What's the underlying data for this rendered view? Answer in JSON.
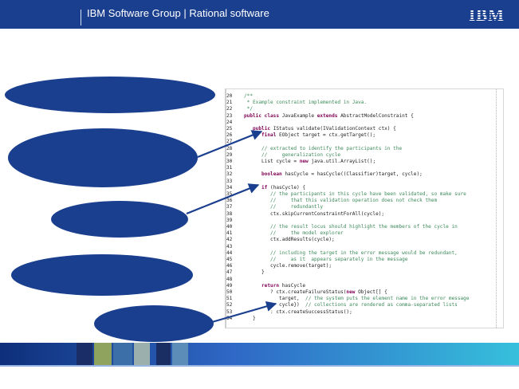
{
  "header": {
    "title": "IBM Software Group  |  Rational software",
    "logo": "IBM"
  },
  "code": {
    "lines": [
      {
        "num": "20",
        "parts": [
          {
            "t": "cm",
            "s": "/**"
          }
        ]
      },
      {
        "num": "21",
        "parts": [
          {
            "t": "cm",
            "s": " * Example constraint implemented in Java."
          }
        ]
      },
      {
        "num": "22",
        "parts": [
          {
            "t": "cm",
            "s": " */"
          }
        ]
      },
      {
        "num": "23",
        "parts": [
          {
            "t": "kw",
            "s": "public class "
          },
          {
            "t": "tx",
            "s": "JavaExample "
          },
          {
            "t": "kw",
            "s": "extends "
          },
          {
            "t": "tx",
            "s": "AbstractModelConstraint {"
          }
        ]
      },
      {
        "num": "24",
        "parts": []
      },
      {
        "num": "25",
        "parts": [
          {
            "t": "tx",
            "s": "   "
          },
          {
            "t": "kw",
            "s": "public "
          },
          {
            "t": "tx",
            "s": "IStatus validate(IValidationContext ctx) {"
          }
        ]
      },
      {
        "num": "26",
        "parts": [
          {
            "t": "tx",
            "s": "      "
          },
          {
            "t": "kw",
            "s": "final "
          },
          {
            "t": "tx",
            "s": "EObject target = ctx.getTarget();"
          }
        ]
      },
      {
        "num": "27",
        "parts": []
      },
      {
        "num": "28",
        "parts": [
          {
            "t": "cm",
            "s": "      // extracted to identify the participants in the"
          }
        ]
      },
      {
        "num": "29",
        "parts": [
          {
            "t": "cm",
            "s": "      //     generalization cycle"
          }
        ]
      },
      {
        "num": "30",
        "parts": [
          {
            "t": "tx",
            "s": "      List cycle = "
          },
          {
            "t": "kw",
            "s": "new "
          },
          {
            "t": "tx",
            "s": "java.util.ArrayList();"
          }
        ]
      },
      {
        "num": "31",
        "parts": []
      },
      {
        "num": "32",
        "parts": [
          {
            "t": "tx",
            "s": "      "
          },
          {
            "t": "kw",
            "s": "boolean "
          },
          {
            "t": "tx",
            "s": "hasCycle = hasCycle((Classifier)target, cycle);"
          }
        ]
      },
      {
        "num": "33",
        "parts": []
      },
      {
        "num": "34",
        "parts": [
          {
            "t": "tx",
            "s": "      "
          },
          {
            "t": "kw",
            "s": "if "
          },
          {
            "t": "tx",
            "s": "(hasCycle) {"
          }
        ]
      },
      {
        "num": "35",
        "parts": [
          {
            "t": "cm",
            "s": "         // the participants in this cycle have been validated, so make sure"
          }
        ]
      },
      {
        "num": "36",
        "parts": [
          {
            "t": "cm",
            "s": "         //     that this validation operation does not check them"
          }
        ]
      },
      {
        "num": "37",
        "parts": [
          {
            "t": "cm",
            "s": "         //     redundantly"
          }
        ]
      },
      {
        "num": "38",
        "parts": [
          {
            "t": "tx",
            "s": "         ctx.skipCurrentConstraintForAll(cycle);"
          }
        ]
      },
      {
        "num": "39",
        "parts": []
      },
      {
        "num": "40",
        "parts": [
          {
            "t": "cm",
            "s": "         // the result locus should highlight the members of the cycle in"
          }
        ]
      },
      {
        "num": "41",
        "parts": [
          {
            "t": "cm",
            "s": "         //     the model explorer"
          }
        ]
      },
      {
        "num": "42",
        "parts": [
          {
            "t": "tx",
            "s": "         ctx.addResults(cycle);"
          }
        ]
      },
      {
        "num": "43",
        "parts": []
      },
      {
        "num": "44",
        "parts": [
          {
            "t": "cm",
            "s": "         // including the target in the error message would be redundant,"
          }
        ]
      },
      {
        "num": "45",
        "parts": [
          {
            "t": "cm",
            "s": "         //     as it  appears separately in the message"
          }
        ]
      },
      {
        "num": "46",
        "parts": [
          {
            "t": "tx",
            "s": "         cycle.remove(target);"
          }
        ]
      },
      {
        "num": "47",
        "parts": [
          {
            "t": "tx",
            "s": "      }"
          }
        ]
      },
      {
        "num": "48",
        "parts": []
      },
      {
        "num": "49",
        "parts": [
          {
            "t": "tx",
            "s": "      "
          },
          {
            "t": "kw",
            "s": "return "
          },
          {
            "t": "tx",
            "s": "hasCycle"
          }
        ]
      },
      {
        "num": "50",
        "parts": [
          {
            "t": "tx",
            "s": "         ? ctx.createFailureStatus("
          },
          {
            "t": "kw",
            "s": "new "
          },
          {
            "t": "tx",
            "s": "Object[] {"
          }
        ]
      },
      {
        "num": "51",
        "parts": [
          {
            "t": "tx",
            "s": "            target,  "
          },
          {
            "t": "cm",
            "s": "// the system puts the element name in the error message"
          }
        ]
      },
      {
        "num": "52",
        "parts": [
          {
            "t": "tx",
            "s": "            cycle})  "
          },
          {
            "t": "cm",
            "s": "// collections are rendered as comma-separated lists"
          }
        ]
      },
      {
        "num": "53",
        "parts": [
          {
            "t": "tx",
            "s": "         : ctx.createSuccessStatus();"
          }
        ]
      },
      {
        "num": "54",
        "parts": [
          {
            "t": "tx",
            "s": "   }"
          }
        ]
      }
    ]
  },
  "colors": {
    "header_bg": "#1b3f8f",
    "bubble_fill": "#1b3f8f",
    "comment": "#3d8a5a",
    "keyword": "#7f0055"
  }
}
